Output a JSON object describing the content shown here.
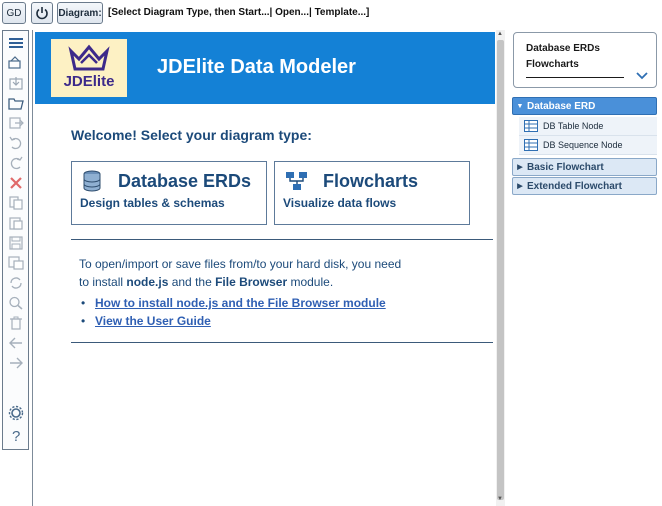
{
  "toolbar": {
    "mode_label": "GD",
    "diagram_label": "Diagram:",
    "menu_text": "[Select Diagram Type, then Start...| Open...| Template...]"
  },
  "header": {
    "logo_text": "JDElite",
    "title": "JDElite Data Modeler"
  },
  "welcome": {
    "heading": "Welcome! Select your diagram type:",
    "cards": [
      {
        "title": "Database ERDs",
        "subtitle": "Design tables & schemas",
        "icon": "database-icon"
      },
      {
        "title": "Flowcharts",
        "subtitle": "Visualize data flows",
        "icon": "flowchart-icon"
      }
    ]
  },
  "info": {
    "line1": "To open/import or save files from/to your hard disk, you need",
    "line2_pre": "to install ",
    "line2_node": "node.js",
    "line2_mid": " and the ",
    "line2_fb": "File Browser",
    "line2_post": " module.",
    "links": [
      {
        "label": "How to install node.js and the File Browser module"
      },
      {
        "label": "View the User Guide"
      }
    ]
  },
  "right_panel": {
    "dropdown_line1": "Database ERDs",
    "dropdown_line2": "Flowcharts",
    "sections": [
      {
        "label": "Database ERD",
        "open": true,
        "items": [
          {
            "label": "DB Table Node"
          },
          {
            "label": "DB Sequence Node"
          }
        ]
      },
      {
        "label": "Basic Flowchart",
        "open": false
      },
      {
        "label": "Extended Flowchart",
        "open": false
      }
    ]
  },
  "left_tools": [
    "menu-icon",
    "import-icon",
    "save-down-icon",
    "open-folder-icon",
    "export-icon",
    "undo-icon",
    "redo-icon",
    "delete-icon",
    "copy-icon",
    "paste-icon",
    "save-icon",
    "save-as-icon",
    "refresh-icon",
    "search-icon",
    "trash-icon",
    "back-arrow-icon",
    "forward-arrow-icon",
    "settings-icon",
    "help-icon"
  ],
  "colors": {
    "header_blue": "#1481d6",
    "text_navy": "#1c4a7a",
    "link_blue": "#2f5fb3",
    "accordion_active": "#4a90d9",
    "logo_bg": "#fdf1c4"
  }
}
